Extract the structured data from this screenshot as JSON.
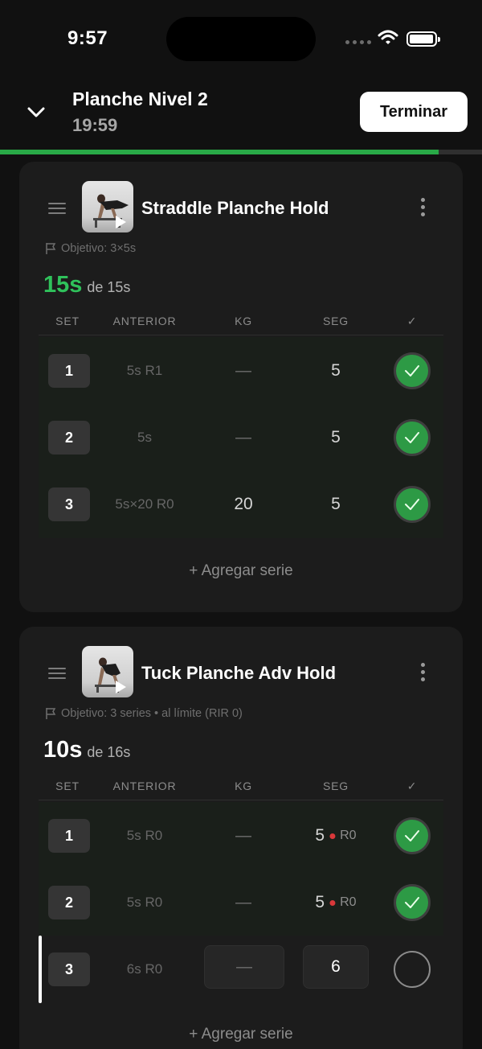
{
  "status_bar": {
    "time": "9:57"
  },
  "workout": {
    "title": "Planche Nivel 2",
    "timer": "19:59",
    "finish_label": "Terminar",
    "progress": 0.91
  },
  "table_headers": {
    "set": "SET",
    "previous": "ANTERIOR",
    "kg": "KG",
    "seg": "SEG",
    "done": "✓"
  },
  "exercises": [
    {
      "name": "Straddle Planche Hold",
      "goal": "Objetivo: 3×5s",
      "total_value": "15s",
      "total_suffix": "de 15s",
      "total_color": "#2fc25b",
      "rows": [
        {
          "set": "1",
          "previous": "5s R1",
          "kg": "—",
          "seg": "5",
          "done": true
        },
        {
          "set": "2",
          "previous": "5s",
          "kg": "—",
          "seg": "5",
          "done": true
        },
        {
          "set": "3",
          "previous": "5s×20 R0",
          "kg": "20",
          "seg": "5",
          "done": true
        }
      ],
      "add_label": "+ Agregar serie"
    },
    {
      "name": "Tuck Planche Adv Hold",
      "goal": "Objetivo: 3 series • al límite (RIR 0)",
      "total_value": "10s",
      "total_suffix": "de 16s",
      "total_color": "#ffffff",
      "rows": [
        {
          "set": "1",
          "previous": "5s R0",
          "kg": "—",
          "seg": "5",
          "rir": "R0",
          "done": true
        },
        {
          "set": "2",
          "previous": "5s R0",
          "kg": "—",
          "seg": "5",
          "rir": "R0",
          "done": true
        },
        {
          "set": "3",
          "previous": "6s R0",
          "kg": "—",
          "seg": "6",
          "done": false
        }
      ],
      "add_label": "+ Agregar serie"
    }
  ],
  "colors": {
    "accent_green": "#2d9a45",
    "rir_dot": "#d9383a",
    "background": "#111111"
  },
  "icons": [
    "chevron-down-icon",
    "wifi-icon",
    "battery-icon",
    "drag-handle-icon",
    "play-icon",
    "more-vertical-icon",
    "flag-icon",
    "check-icon"
  ]
}
